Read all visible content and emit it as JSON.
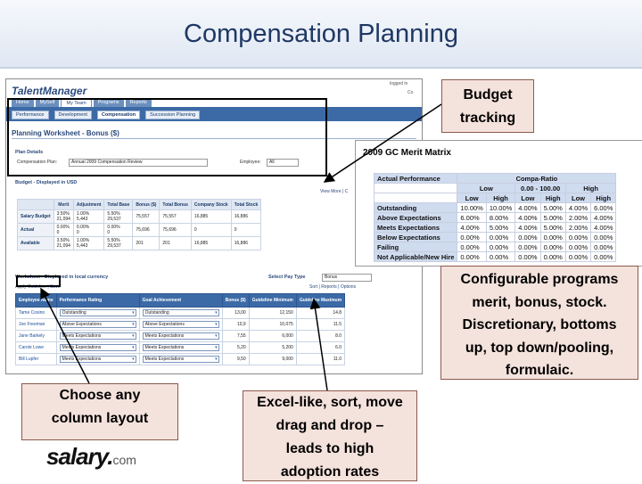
{
  "slide": {
    "title": "Compensation Planning"
  },
  "app": {
    "product": "TalentManager",
    "logged_in": "logged in",
    "user_short": "Co",
    "tabs": [
      {
        "label": "Home"
      },
      {
        "label": "MySelf"
      },
      {
        "label": "My Team"
      },
      {
        "label": "Programs"
      },
      {
        "label": "Reports"
      }
    ],
    "subtabs": [
      {
        "label": "Performance"
      },
      {
        "label": "Development"
      },
      {
        "label": "Compensation"
      },
      {
        "label": "Succession Planning"
      }
    ],
    "worksheet_title": "Planning Worksheet - Bonus ($)",
    "plan_details": {
      "header": "Plan Details",
      "comp_plan_label": "Compensation Plan:",
      "comp_plan_value": "Annual 2009 Compensation Review",
      "employee_label": "Employee:",
      "employee_value": "All"
    },
    "budget": {
      "header": "Budget - Displayed in USD",
      "links": "View More | C",
      "columns": [
        "",
        "Merit",
        "Adjustment",
        "Total Base",
        "Bonus ($)",
        "Total Bonus",
        "Company Stock",
        "Total Stock"
      ],
      "rows": [
        {
          "label": "Salary Budget",
          "cells": [
            "3.50%\n21,094",
            "1.00%\n5,443",
            "5.50%\n29,537",
            "75,557",
            "75,557",
            "16,885",
            "16,886"
          ]
        },
        {
          "label": "Actual",
          "cells": [
            "0.00%\n0",
            "0.00%\n0",
            "0.00%\n0",
            "75,696",
            "75,696",
            "0",
            "0"
          ]
        },
        {
          "label": "Available",
          "cells": [
            "3.50%\n21,094",
            "1.00%\n5,443",
            "5.50%\n29,537",
            "201",
            "201",
            "16,885",
            "16,886"
          ]
        }
      ]
    },
    "worksheet": {
      "header": "Worksheet - Displayed in local currency",
      "pay_type_label": "Select Pay Type",
      "pay_type_value": "Bonus",
      "apply_links": "Apply Guideline | Save",
      "sort_links": "Sort | Reports | Options",
      "columns": [
        "Employee Name",
        "Performance Rating",
        "Goal Achievement",
        "Bonus ($)",
        "Guideline Minimum",
        "Guideline Maximum"
      ],
      "rows": [
        {
          "name": "Tame Cosino",
          "rating": "Outstanding",
          "goal": "Outstanding",
          "bonus": "13,00",
          "min": "12,150",
          "max": "14.8"
        },
        {
          "name": "Joe Freeman",
          "rating": "Above Expectations",
          "goal": "Above Expectations",
          "bonus": "10,9",
          "min": "10,075",
          "max": "11.5"
        },
        {
          "name": "Jane Barkely",
          "rating": "Meets Expectations",
          "goal": "Meets Expectations",
          "bonus": "7,55",
          "min": "6,000",
          "max": "8.0"
        },
        {
          "name": "Carole Lowe",
          "rating": "Meets Expectations",
          "goal": "Meets Expectations",
          "bonus": "5,20",
          "min": "5,200",
          "max": "6.0"
        },
        {
          "name": "Bill Lupfer",
          "rating": "Meets Expectations",
          "goal": "Meets Expectations",
          "bonus": "9,50",
          "min": "9,000",
          "max": "11.0"
        }
      ]
    }
  },
  "matrix": {
    "title": "2009 GC Merit Matrix",
    "actual_performance": "Actual Performance",
    "compa_ratio": "Compa-Ratio",
    "range_low": "Low",
    "range_mid": "0.00 - 100.00",
    "range_high": "High",
    "sub_headers": [
      "Low",
      "High",
      "Low",
      "High",
      "Low",
      "High"
    ],
    "rows": [
      {
        "label": "Outstanding",
        "cells": [
          "10.00%",
          "10.00%",
          "4.00%",
          "5.00%",
          "4.00%",
          "6.00%"
        ]
      },
      {
        "label": "Above Expectations",
        "cells": [
          "6.00%",
          "8.00%",
          "4.00%",
          "5.00%",
          "2.00%",
          "4.00%"
        ]
      },
      {
        "label": "Meets Expectations",
        "cells": [
          "4.00%",
          "5.00%",
          "4.00%",
          "5.00%",
          "2.00%",
          "4.00%"
        ]
      },
      {
        "label": "Below Expectations",
        "cells": [
          "0.00%",
          "0.00%",
          "0.00%",
          "0.00%",
          "0.00%",
          "0.00%"
        ]
      },
      {
        "label": "Failing",
        "cells": [
          "0.00%",
          "0.00%",
          "0.00%",
          "0.00%",
          "0.00%",
          "0.00%"
        ]
      },
      {
        "label": "Not Applicable/New Hire",
        "cells": [
          "0.00%",
          "0.00%",
          "0.00%",
          "0.00%",
          "0.00%",
          "0.00%"
        ]
      }
    ]
  },
  "callouts": {
    "budget": [
      "Budget",
      "tracking"
    ],
    "programs": [
      "Configurable programs",
      "merit, bonus, stock.",
      "Discretionary, bottoms",
      "up, top down/pooling,",
      "formulaic."
    ],
    "columns": [
      "Choose any",
      "column layout"
    ],
    "excel": [
      "Excel-like, sort, move",
      "drag and drop –",
      "leads to high",
      "adoption rates"
    ]
  },
  "logo": {
    "word": "salary",
    "dot": ".",
    "com": "com"
  },
  "colors": {
    "title": "#1f3864",
    "callout_fill": "#f4e2dc",
    "callout_border": "#8c5a4e",
    "app_blue": "#3c6aa6"
  }
}
